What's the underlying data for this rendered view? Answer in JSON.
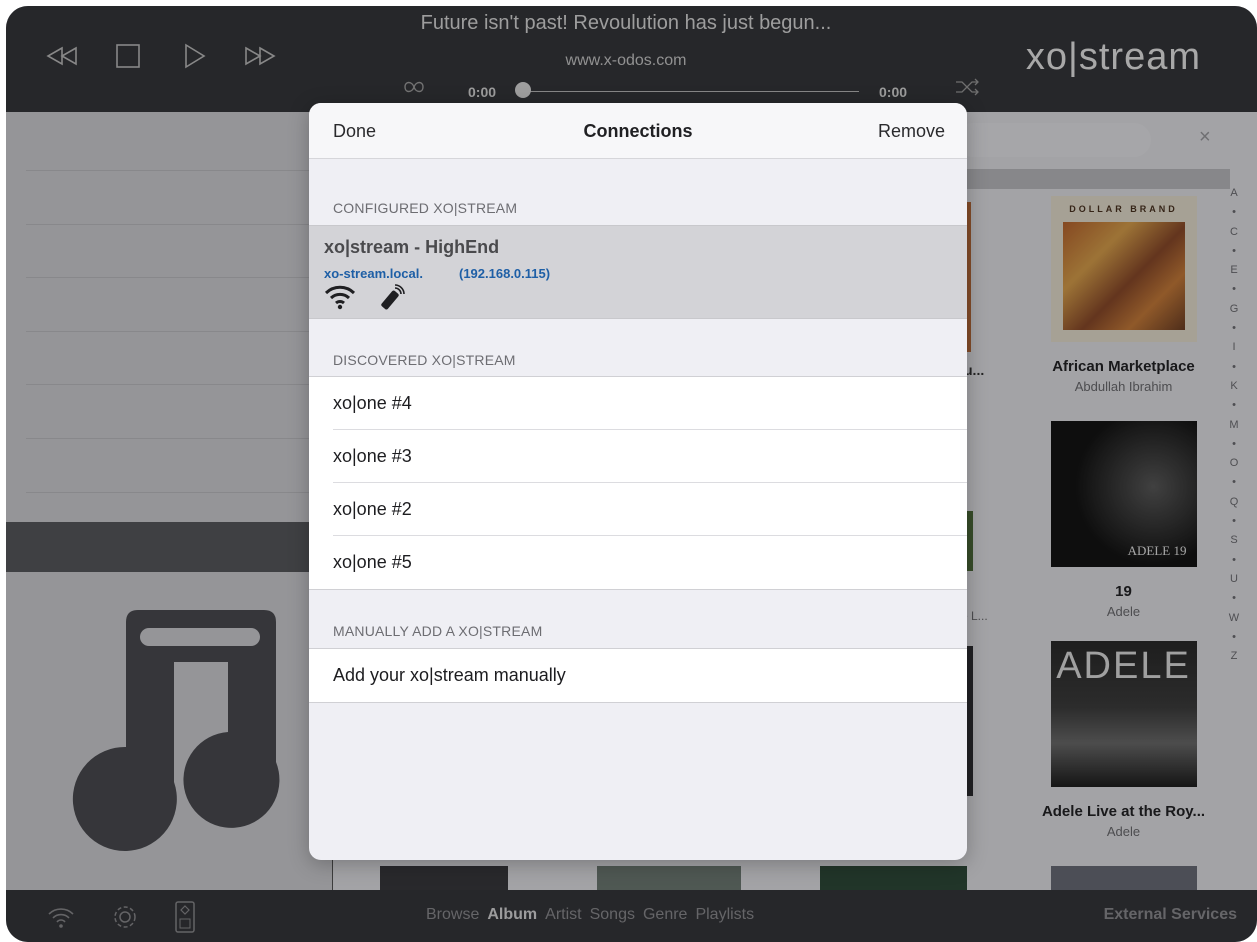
{
  "player": {
    "marquee": "Future isn't past! Revoulution has just begun...",
    "url": "www.x-odos.com",
    "brand": "xo|stream",
    "time_elapsed": "0:00",
    "time_total": "0:00",
    "progress": 0
  },
  "modal": {
    "done_label": "Done",
    "title": "Connections",
    "remove_label": "Remove",
    "configured_header": "CONFIGURED XO|STREAM",
    "configured": {
      "name": "xo|stream - HighEnd",
      "host": "xo-stream.local.",
      "ip": "(192.168.0.115)"
    },
    "discovered_header": "DISCOVERED XO|STREAM",
    "discovered": [
      "xo|one #4",
      "xo|one #3",
      "xo|one #2",
      "xo|one #5"
    ],
    "manual_header": "MANUALLY ADD A XO|STREAM",
    "manual_label": "Add your xo|stream manually"
  },
  "albums": [
    {
      "title": "African Marketplace",
      "artist": "Abdullah Ibrahim",
      "cover_text": "DOLLAR BRAND"
    },
    {
      "title": "19",
      "artist": "Adele",
      "cover_text": "ADELE 19"
    },
    {
      "title": "Adele Live at the Roy...",
      "artist": "Adele",
      "cover_text": "ADELE"
    }
  ],
  "partials": {
    "row1": "u...",
    "row2": "e L..."
  },
  "index_letters": [
    "A",
    "•",
    "C",
    "•",
    "E",
    "•",
    "G",
    "•",
    "I",
    "•",
    "K",
    "•",
    "M",
    "•",
    "O",
    "•",
    "Q",
    "•",
    "S",
    "•",
    "U",
    "•",
    "W",
    "•",
    "Z"
  ],
  "tabs": {
    "browse": "Browse",
    "album": "Album",
    "artist": "Artist",
    "songs": "Songs",
    "genre": "Genre",
    "playlists": "Playlists"
  },
  "external": "External Services"
}
